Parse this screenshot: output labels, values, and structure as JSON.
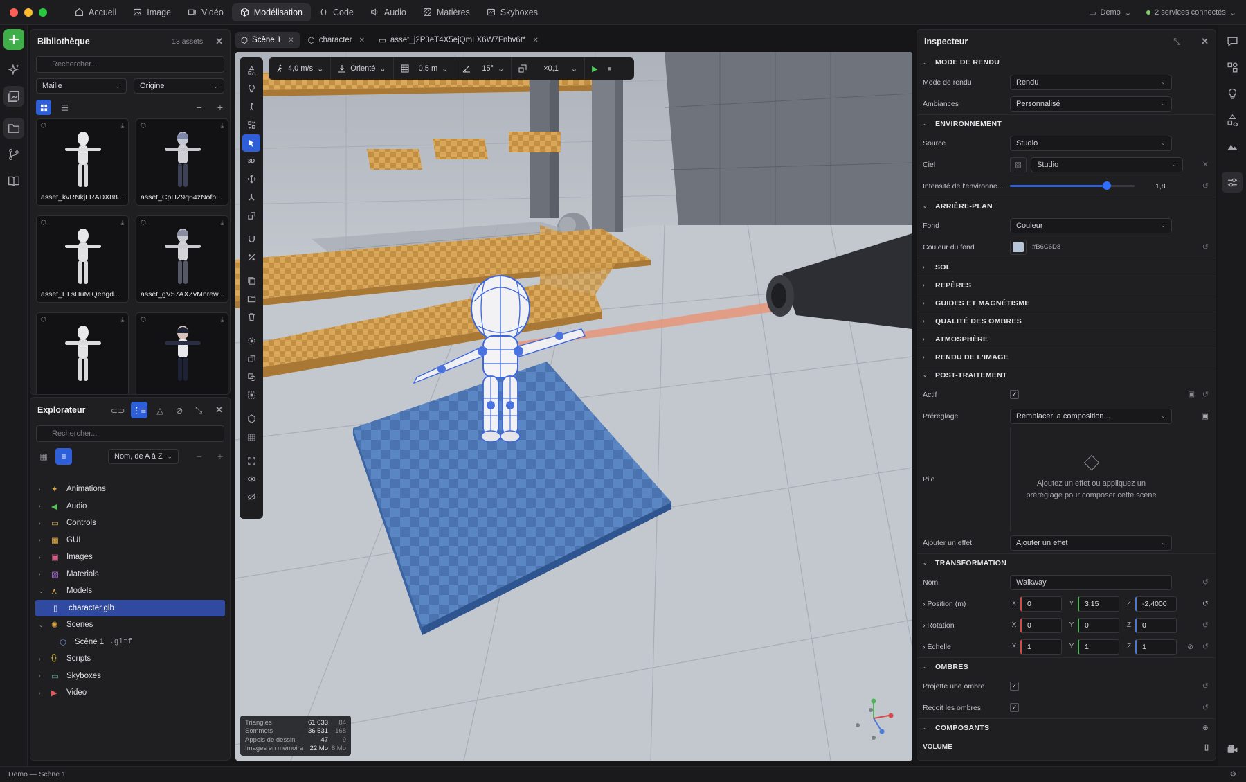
{
  "nav": {
    "items": [
      {
        "label": "Accueil",
        "icon": "home-icon"
      },
      {
        "label": "Image",
        "icon": "image-icon"
      },
      {
        "label": "Vidéo",
        "icon": "video-icon"
      },
      {
        "label": "Modélisation",
        "icon": "cube-icon",
        "active": true
      },
      {
        "label": "Code",
        "icon": "code-icon"
      },
      {
        "label": "Audio",
        "icon": "audio-icon"
      },
      {
        "label": "Matières",
        "icon": "texture-icon"
      },
      {
        "label": "Skyboxes",
        "icon": "skybox-icon"
      }
    ],
    "project": "Demo",
    "services": "2 services connectés"
  },
  "library": {
    "title": "Bibliothèque",
    "count": "13 assets",
    "search_placeholder": "Rechercher...",
    "filter_type": "Maille",
    "filter_origin": "Origine",
    "assets": [
      {
        "name": "asset_kvRNkjLRADX88..."
      },
      {
        "name": "asset_CpHZ9q64zNofp..."
      },
      {
        "name": "asset_ELsHuMiQengd..."
      },
      {
        "name": "asset_gV57AXZvMnrew..."
      },
      {
        "name": ""
      },
      {
        "name": ""
      }
    ]
  },
  "explorer": {
    "title": "Explorateur",
    "search_placeholder": "Rechercher...",
    "sort": "Nom, de A à Z",
    "tree": [
      {
        "label": "Animations",
        "icon": "animation-icon",
        "color": "#e0a73a"
      },
      {
        "label": "Audio",
        "icon": "audio-icon",
        "color": "#5cc15c"
      },
      {
        "label": "Controls",
        "icon": "gamepad-icon",
        "color": "#e0a73a"
      },
      {
        "label": "GUI",
        "icon": "gui-icon",
        "color": "#e0a73a"
      },
      {
        "label": "Images",
        "icon": "image-icon",
        "color": "#e05a8a"
      },
      {
        "label": "Materials",
        "icon": "material-icon",
        "color": "#a86ae0"
      },
      {
        "label": "Models",
        "icon": "model-icon",
        "color": "#e0a73a",
        "expanded": true
      },
      {
        "label": "character.glb",
        "icon": "file-icon",
        "color": "#ffffff",
        "selected": true,
        "child": true
      },
      {
        "label": "Scenes",
        "icon": "scene-icon",
        "color": "#e0a73a",
        "expanded": true
      },
      {
        "label": "Scène 1",
        "suffix": ".gltf",
        "icon": "cube-icon",
        "color": "#6a8ae0",
        "child": true
      },
      {
        "label": "Scripts",
        "icon": "code-icon",
        "color": "#e0c23a"
      },
      {
        "label": "Skyboxes",
        "icon": "skybox-icon",
        "color": "#4fb4a0"
      },
      {
        "label": "Video",
        "icon": "video-icon",
        "color": "#e05a5a"
      }
    ]
  },
  "tabs": [
    {
      "label": "Scène 1",
      "active": true
    },
    {
      "label": "character"
    },
    {
      "label": "asset_j2P3eT4X5ejQmLX6W7Fnbv6t*"
    }
  ],
  "viewport_bar": {
    "speed": "4,0 m/s",
    "orientation": "Orienté",
    "grid": "0,5 m",
    "angle": "15°",
    "scale": "×0,1"
  },
  "stats": [
    {
      "label": "Triangles",
      "v1": "61 033",
      "v2": "84"
    },
    {
      "label": "Sommets",
      "v1": "36 531",
      "v2": "168"
    },
    {
      "label": "Appels de dessin",
      "v1": "47",
      "v2": "9"
    },
    {
      "label": "Images en mémoire",
      "v1": "22 Mo",
      "v2": "8 Mo"
    }
  ],
  "inspector": {
    "title": "Inspecteur",
    "sec_render": "MODE DE RENDU",
    "render_mode_label": "Mode de rendu",
    "render_mode": "Rendu",
    "ambiance_label": "Ambiances",
    "ambiance": "Personnalisé",
    "sec_env": "ENVIRONNEMENT",
    "source_label": "Source",
    "source": "Studio",
    "sky_label": "Ciel",
    "sky": "Studio",
    "intensity_label": "Intensité de l'environne...",
    "intensity": "1,8",
    "intensity_fraction": 0.78,
    "sec_bg": "ARRIÈRE-PLAN",
    "bg_label": "Fond",
    "bg": "Couleur",
    "bg_color_label": "Couleur du fond",
    "bg_color": "#B6C6D8",
    "collapsed": [
      "SOL",
      "REPÈRES",
      "GUIDES ET MAGNÉTISME",
      "QUALITÉ DES OMBRES",
      "ATMOSPHÈRE",
      "RENDU DE L'IMAGE"
    ],
    "sec_post": "POST-TRAITEMENT",
    "active_label": "Actif",
    "preset_label": "Préréglage",
    "preset": "Remplacer la composition...",
    "stack_label": "Pile",
    "stack_hint": "Ajoutez un effet ou appliquez un préréglage pour composer cette scène",
    "add_effect_label": "Ajouter un effet",
    "add_effect": "Ajouter un effet",
    "sec_transform": "TRANSFORMATION",
    "name_label": "Nom",
    "name": "Walkway",
    "position_label": "Position (m)",
    "pos": [
      "0",
      "3,15",
      "-2,4000"
    ],
    "rotation_label": "Rotation",
    "rot": [
      "0",
      "0",
      "0"
    ],
    "scale_label": "Échelle",
    "scl": [
      "1",
      "1",
      "1"
    ],
    "sec_shadows": "OMBRES",
    "cast_label": "Projette une ombre",
    "receive_label": "Reçoit les ombres",
    "sec_components": "COMPOSANTS",
    "volume": "VOLUME"
  },
  "status": "Demo — Scène 1"
}
